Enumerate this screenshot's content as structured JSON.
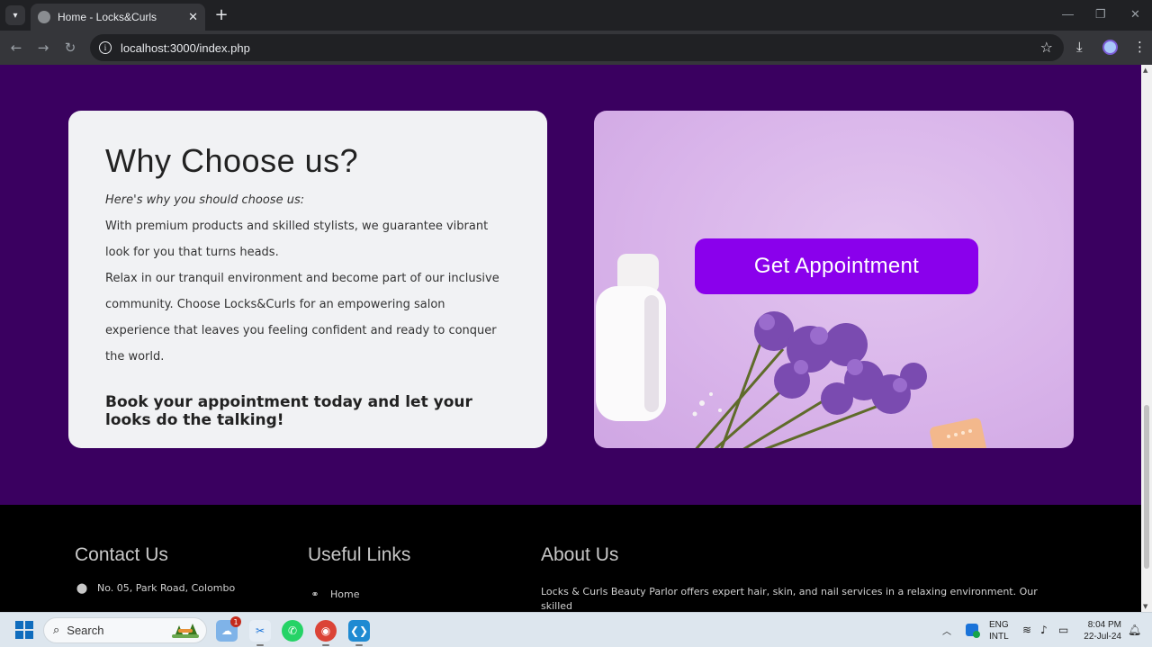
{
  "browser": {
    "tab_title": "Home - Locks&Curls",
    "url": "localhost:3000/index.php",
    "controls": {
      "minimize": "—",
      "maximize": "❐",
      "close": "✕"
    }
  },
  "why": {
    "title": "Why Choose us?",
    "intro": "Here's why you should choose us:",
    "body": "With premium products and skilled stylists, we guarantee vibrant look for you that turns heads.",
    "body2": "Relax in our tranquil environment and become part of our inclusive community. Choose Locks&Curls for an empowering salon experience that leaves you feeling confident and ready to conquer the world.",
    "cta": "Book your appointment today and let your looks do the talking!"
  },
  "appointment": {
    "button_label": "Get Appointment"
  },
  "footer": {
    "contact_heading": "Contact Us",
    "contact_address": "No. 05, Park Road, Colombo",
    "links_heading": "Useful Links",
    "link_home": "Home",
    "about_heading": "About Us",
    "about_text": "Locks & Curls Beauty Parlor offers expert hair, skin, and nail services in a relaxing environment. Our skilled"
  },
  "taskbar": {
    "search_placeholder": "Search",
    "notification_count": "1",
    "lang_line1": "ENG",
    "lang_line2": "INTL",
    "time": "8:04 PM",
    "date": "22-Jul-24"
  },
  "colors": {
    "page_bg": "#3a0060",
    "button": "#8a00ec",
    "card": "#f1f2f4",
    "footer": "#000000"
  }
}
